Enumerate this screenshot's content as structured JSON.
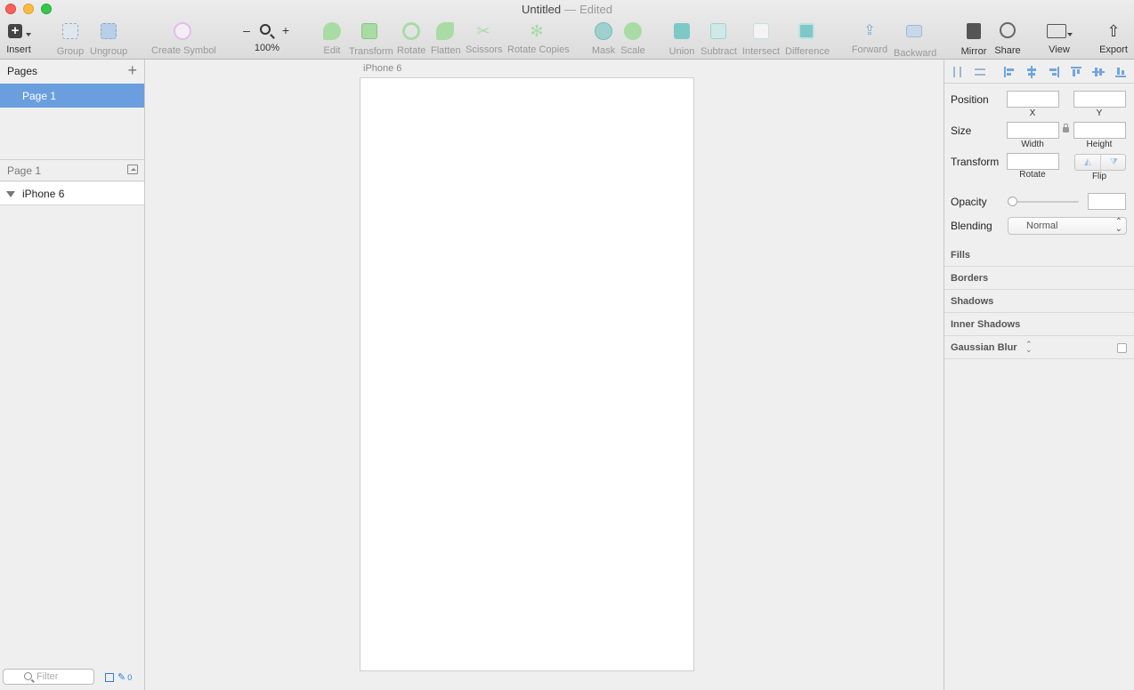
{
  "window": {
    "title": "Untitled",
    "separator": "—",
    "status": "Edited"
  },
  "toolbar": {
    "insert": "Insert",
    "group": "Group",
    "ungroup": "Ungroup",
    "create_symbol": "Create Symbol",
    "zoom_out": "–",
    "zoom_in": "+",
    "zoom_level": "100%",
    "edit": "Edit",
    "transform": "Transform",
    "rotate": "Rotate",
    "flatten": "Flatten",
    "scissors": "Scissors",
    "rotate_copies": "Rotate Copies",
    "mask": "Mask",
    "scale": "Scale",
    "union": "Union",
    "subtract": "Subtract",
    "intersect": "Intersect",
    "difference": "Difference",
    "forward": "Forward",
    "backward": "Backward",
    "mirror": "Mirror",
    "share": "Share",
    "view": "View",
    "export": "Export"
  },
  "pages_panel": {
    "title": "Pages",
    "add": "+",
    "pages": [
      "Page 1"
    ]
  },
  "layers_panel": {
    "page_name": "Page 1",
    "layers": [
      "iPhone 6"
    ]
  },
  "filter": {
    "placeholder": "Filter",
    "count": "0"
  },
  "canvas": {
    "artboard_label": "iPhone 6"
  },
  "inspector": {
    "position": "Position",
    "x": "X",
    "y": "Y",
    "size": "Size",
    "width": "Width",
    "height": "Height",
    "transform": "Transform",
    "rotate": "Rotate",
    "flip": "Flip",
    "opacity": "Opacity",
    "opacity_value": 0,
    "blending": "Blending",
    "blending_value": "Normal",
    "sections": [
      "Fills",
      "Borders",
      "Shadows",
      "Inner Shadows",
      "Gaussian Blur"
    ]
  },
  "colors": {
    "selection": "#6a9ede",
    "accent": "#2d7fd6",
    "tool_teal": "#7ec8c8"
  }
}
